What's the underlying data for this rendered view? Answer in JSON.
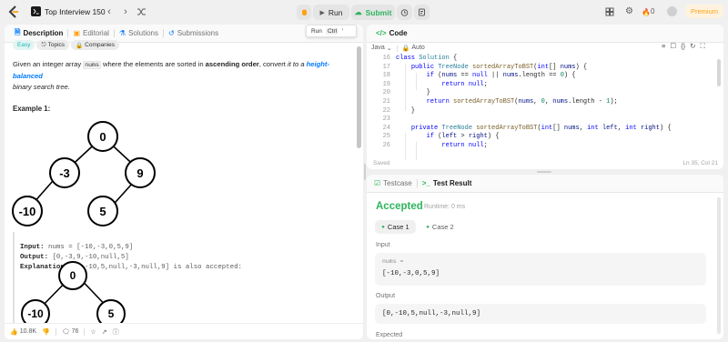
{
  "topbar": {
    "problem_list": "Top Interview 150",
    "run": "Run",
    "submit": "Submit",
    "streak": "0",
    "premium": "Premium"
  },
  "left": {
    "tabs": [
      "Description",
      "Editorial",
      "Solutions",
      "Submissions"
    ],
    "tooltip": {
      "label": "Run",
      "shortcut": "Ctrl",
      "key": "'"
    },
    "tags": [
      "Easy",
      "Topics",
      "Companies"
    ],
    "desc": {
      "p1": "Given an integer array ",
      "code": "nums",
      "p2": " where the elements are sorted in ",
      "b1": "ascending order",
      "p3": ", convert ",
      "i1": "it to a ",
      "link": "height-balanced",
      "line2": "binary search tree."
    },
    "example_title": "Example 1:",
    "tree1": {
      "root": "0",
      "l": "-3",
      "r": "9",
      "ll": "-10",
      "rl": "5"
    },
    "example": {
      "input_label": "Input:",
      "input_val": " nums = [-10,-3,0,5,9]",
      "output_label": "Output:",
      "output_val": " [0,-3,9,-10,null,5]",
      "expl_label": "Explanation:",
      "expl_val": " [0,-10,5,null,-3,null,9] is also accepted:"
    },
    "tree2": {
      "root": "0",
      "l": "-10",
      "r": "5"
    },
    "footer": {
      "likes": "10.8K",
      "comments": "76"
    }
  },
  "code": {
    "title": "Code",
    "language": "Java",
    "mode": "Auto",
    "saved": "Saved",
    "cursor": "Ln 35, Col 21"
  },
  "result": {
    "tabs": [
      "Testcase",
      "Test Result"
    ],
    "status": "Accepted",
    "runtime": "Runtime: 0 ms",
    "cases": [
      "Case 1",
      "Case 2"
    ],
    "input_label": "Input",
    "param_name": "nums =",
    "param_value": "[-10,-3,0,5,9]",
    "output_label": "Output",
    "output_value": "[0,-10,5,null,-3,null,9]",
    "expected_label": "Expected"
  },
  "colors": {
    "accent": "#2db55d",
    "run_bg": "#e5e5e5",
    "premium": "#ffa116",
    "link": "#007aff"
  }
}
